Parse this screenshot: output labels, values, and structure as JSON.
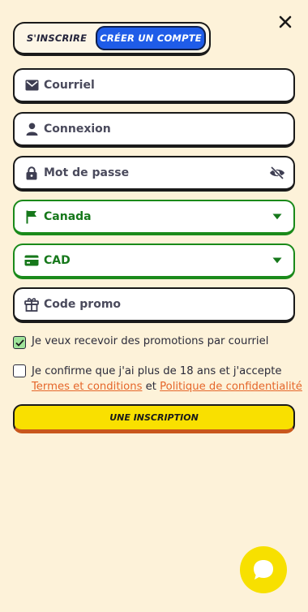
{
  "tabs": {
    "login": "S'INSCRIRE",
    "register": "CRÉER UN COMPTE"
  },
  "fields": {
    "email": {
      "placeholder": "Courriel",
      "icon": "envelope-icon"
    },
    "username": {
      "placeholder": "Connexion",
      "icon": "user-icon"
    },
    "password": {
      "placeholder": "Mot de passe",
      "icon": "lock-icon",
      "toggle_icon": "eye-off-icon"
    },
    "country": {
      "value": "Canada",
      "icon": "flag-icon"
    },
    "currency": {
      "value": "CAD",
      "icon": "card-icon"
    },
    "promo": {
      "placeholder": "Code promo",
      "icon": "gift-icon"
    }
  },
  "checks": {
    "promotions": {
      "label": "Je veux recevoir des promotions par courriel",
      "checked": true
    },
    "terms": {
      "text": "Je confirme que j'ai plus de 18 ans et j'accepte",
      "terms_link": "Termes et conditions",
      "and": " et ",
      "privacy_link": "Politique de confidentialité",
      "checked": false
    }
  },
  "submit_label": "UNE INSCRIPTION",
  "colors": {
    "background": "#fdf2d9",
    "accent": "#1f5ce8",
    "green": "#1a8a1a",
    "yellow": "#f9e000",
    "link": "#e5662a"
  }
}
